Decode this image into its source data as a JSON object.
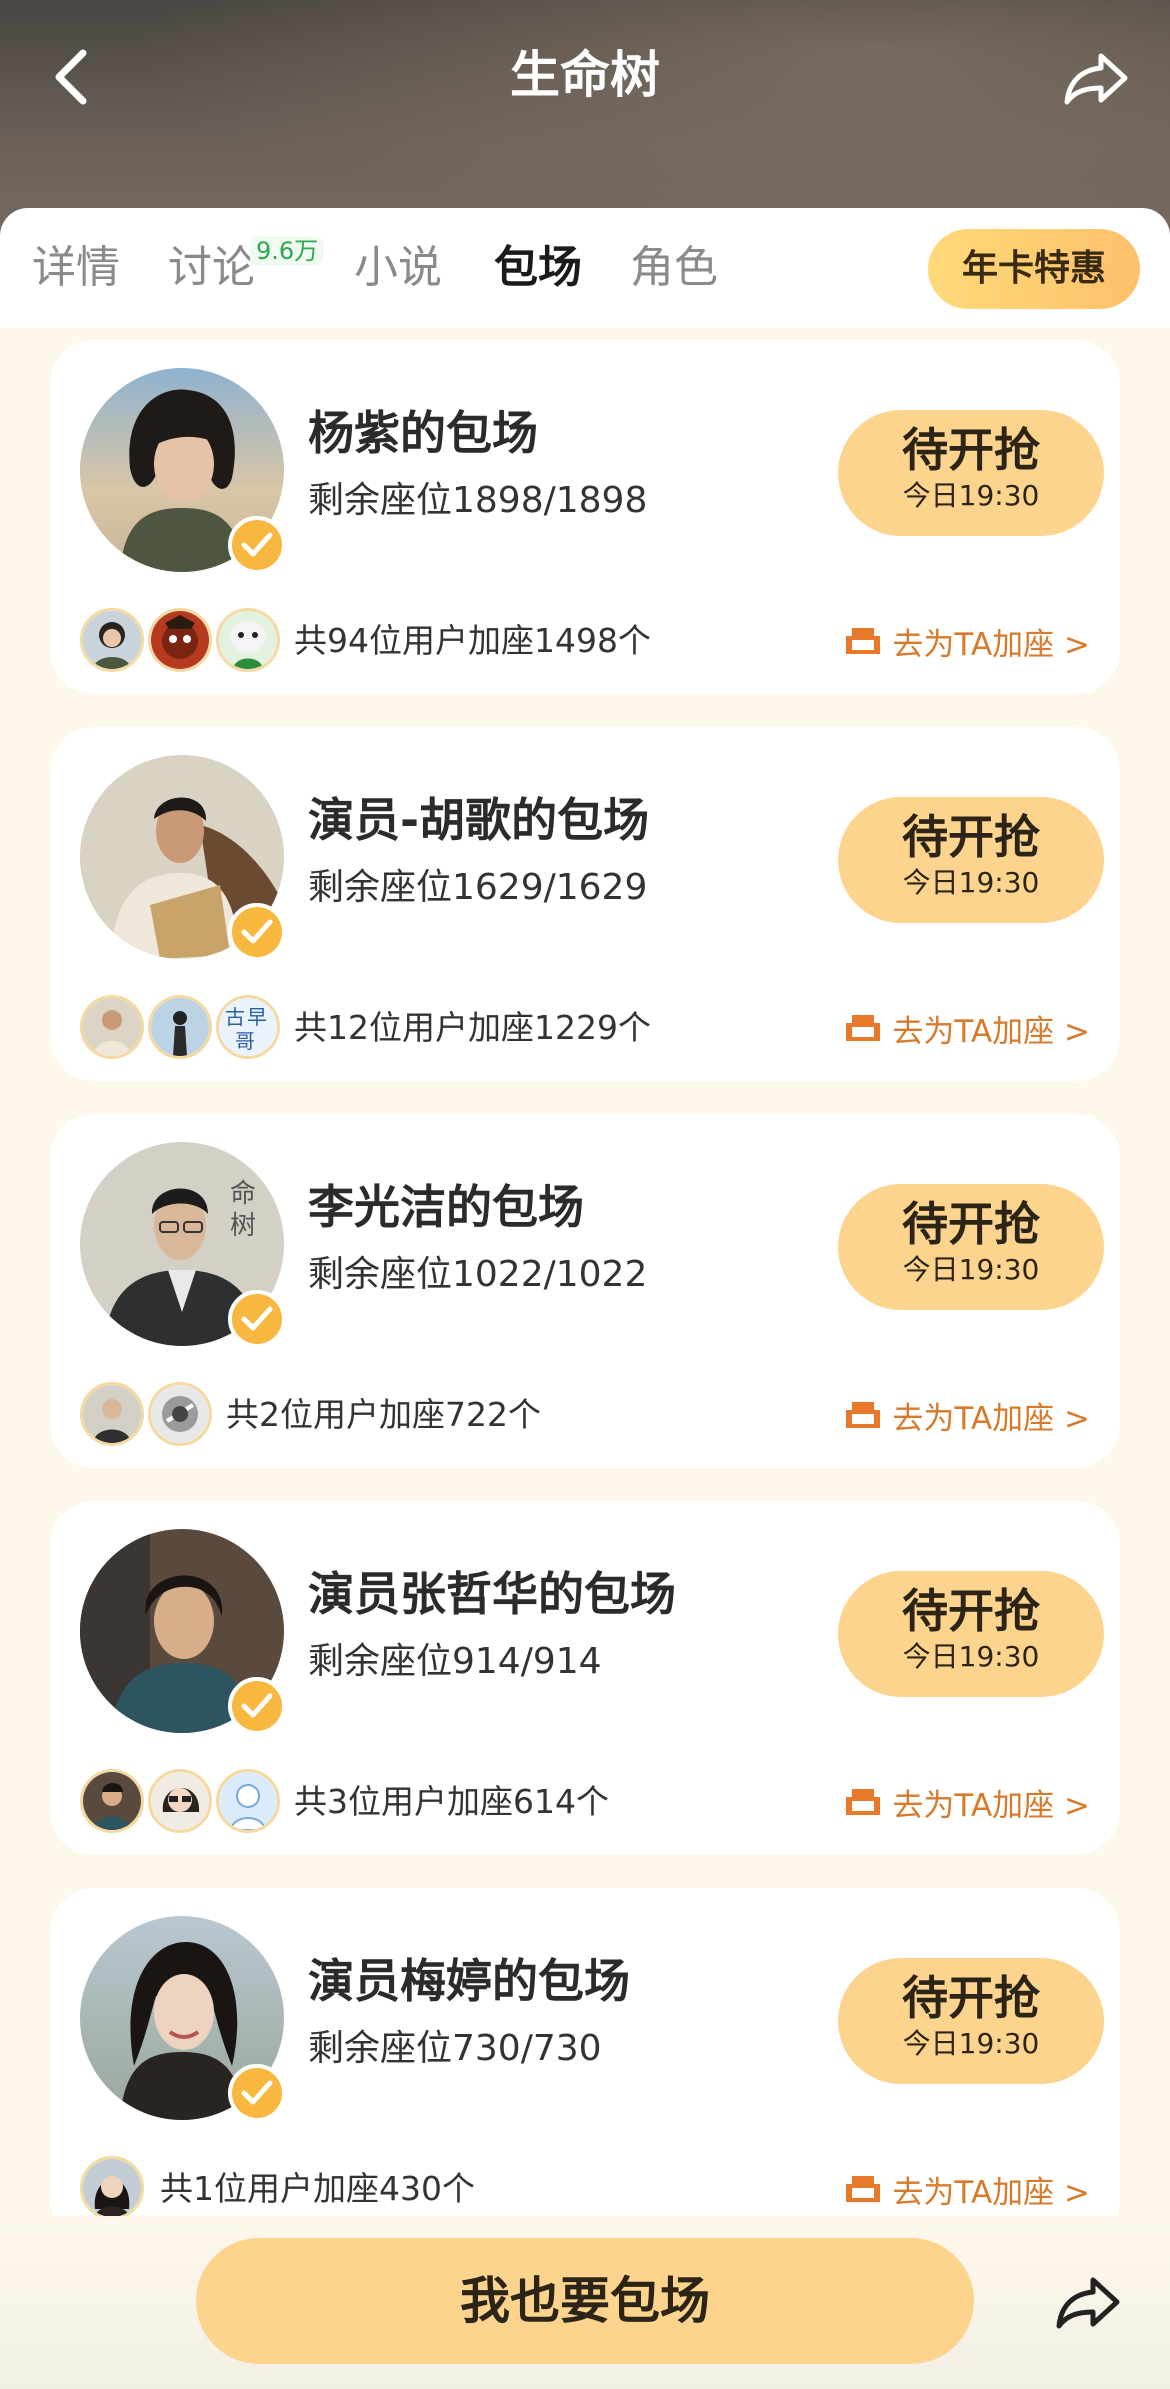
{
  "header": {
    "title": "生命树"
  },
  "tabs": [
    {
      "label": "详情",
      "active": false
    },
    {
      "label": "讨论",
      "active": false,
      "badge": "9.6万"
    },
    {
      "label": "小说",
      "active": false
    },
    {
      "label": "包场",
      "active": true
    },
    {
      "label": "角色",
      "active": false
    }
  ],
  "vip_button": "年卡特惠",
  "cards": [
    {
      "title": "杨紫的包场",
      "seats": "剩余座位1898/1898",
      "button_main": "待开抢",
      "button_time": "今日19:30",
      "supporters": "共94位用户加座1498个",
      "add_link": "去为TA加座 >"
    },
    {
      "title": "演员-胡歌的包场",
      "seats": "剩余座位1629/1629",
      "button_main": "待开抢",
      "button_time": "今日19:30",
      "supporters": "共12位用户加座1229个",
      "add_link": "去为TA加座 >"
    },
    {
      "title": "李光洁的包场",
      "seats": "剩余座位1022/1022",
      "button_main": "待开抢",
      "button_time": "今日19:30",
      "supporters": "共2位用户加座722个",
      "add_link": "去为TA加座 >"
    },
    {
      "title": "演员张哲华的包场",
      "seats": "剩余座位914/914",
      "button_main": "待开抢",
      "button_time": "今日19:30",
      "supporters": "共3位用户加座614个",
      "add_link": "去为TA加座 >"
    },
    {
      "title": "演员梅婷的包场",
      "seats": "剩余座位730/730",
      "button_main": "待开抢",
      "button_time": "今日19:30",
      "supporters": "共1位用户加座430个",
      "add_link": "去为TA加座 >"
    }
  ],
  "bottom": {
    "cta": "我也要包场"
  },
  "colors": {
    "accent": "#fdd48e",
    "link": "#d77a2c",
    "verify": "#f8b73e",
    "badge_text": "#2ea84e"
  },
  "icons": [
    "back-arrow-icon",
    "share-icon",
    "verified-icon",
    "seat-icon"
  ]
}
